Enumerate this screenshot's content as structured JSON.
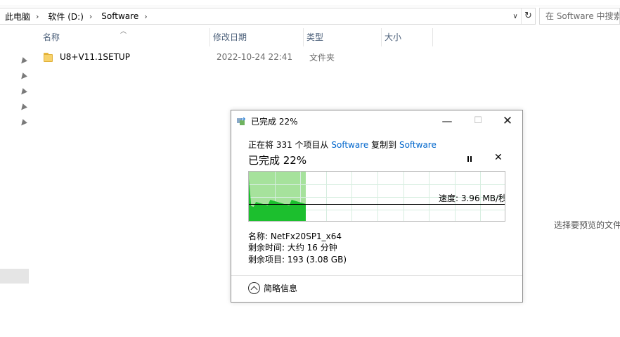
{
  "explorer": {
    "breadcrumbs": [
      "此电脑",
      "软件 (D:)",
      "Software"
    ],
    "search_placeholder": "在 Software 中搜索",
    "columns": {
      "name": "名称",
      "date": "修改日期",
      "type": "类型",
      "size": "大小"
    },
    "files": [
      {
        "name": "U8+V11.1SETUP",
        "date": "2022-10-24 22:41",
        "type": "文件夹"
      }
    ],
    "preview_message": "选择要预览的文件。",
    "icons": {
      "pin": "pin-icon",
      "folder": "folder-icon",
      "refresh": "refresh-icon"
    }
  },
  "copy_dialog": {
    "title": "已完成 22%",
    "copy_prefix": "正在将 331 个项目从",
    "source": "Software",
    "copy_middle": "复制到",
    "destination": "Software",
    "progress_label": "已完成 22%",
    "progress": 0.22,
    "speed": "速度: 3.96 MB/秒",
    "name_line": "名称: NetFx20SP1_x64",
    "time_remaining": "剩余时间: 大约 16 分钟",
    "items_remaining": "剩余项目: 193 (3.08 GB)",
    "less_info": "简略信息",
    "colors": {
      "progress_fill": "#a6e29c",
      "throughput": "#1cbf2e",
      "link": "#0066cc"
    }
  }
}
